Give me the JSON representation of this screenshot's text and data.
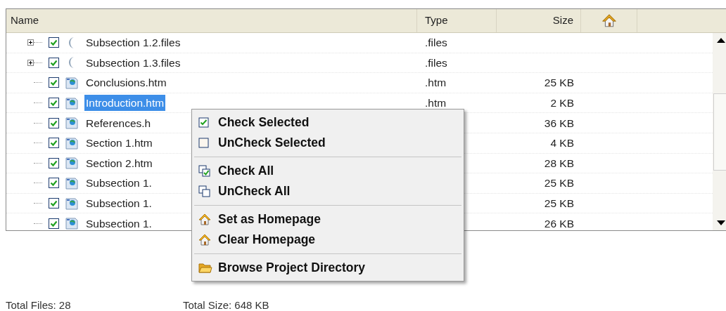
{
  "table": {
    "columns": [
      "Name",
      "Type",
      "Size"
    ],
    "rows": [
      {
        "kind": "folder",
        "expanded": false,
        "checked": true,
        "selected": false,
        "name": "Subsection 1.2.files",
        "type": ".files",
        "size": ""
      },
      {
        "kind": "folder",
        "expanded": false,
        "checked": true,
        "selected": false,
        "name": "Subsection 1.3.files",
        "type": ".files",
        "size": ""
      },
      {
        "kind": "page",
        "checked": true,
        "selected": false,
        "name": "Conclusions.htm",
        "type": ".htm",
        "size": "25 KB"
      },
      {
        "kind": "page",
        "checked": true,
        "selected": true,
        "name": "Introduction.htm",
        "type": ".htm",
        "size": "2 KB"
      },
      {
        "kind": "page",
        "checked": true,
        "selected": false,
        "name": "References.h",
        "type": "",
        "size": "36 KB"
      },
      {
        "kind": "page",
        "checked": true,
        "selected": false,
        "name": "Section 1.htm",
        "type": "",
        "size": "4 KB"
      },
      {
        "kind": "page",
        "checked": true,
        "selected": false,
        "name": "Section 2.htm",
        "type": "",
        "size": "28 KB"
      },
      {
        "kind": "page",
        "checked": true,
        "selected": false,
        "name": "Subsection 1.",
        "type": "",
        "size": "25 KB"
      },
      {
        "kind": "page",
        "checked": true,
        "selected": false,
        "name": "Subsection 1.",
        "type": "",
        "size": "25 KB"
      },
      {
        "kind": "page",
        "checked": true,
        "selected": false,
        "name": "Subsection 1.",
        "type": "",
        "size": "26 KB"
      }
    ]
  },
  "context_menu": {
    "groups": [
      [
        {
          "kind": "check",
          "label": "Check Selected"
        },
        {
          "kind": "uncheck",
          "label": "UnCheck Selected"
        }
      ],
      [
        {
          "kind": "check_all",
          "label": "Check All"
        },
        {
          "kind": "uncheck_all",
          "label": "UnCheck All"
        }
      ],
      [
        {
          "kind": "home",
          "label": "Set as Homepage"
        },
        {
          "kind": "home",
          "label": "Clear Homepage"
        }
      ],
      [
        {
          "kind": "folder",
          "label": "Browse Project Directory"
        }
      ]
    ]
  },
  "status_bar": {
    "total_files": {
      "label": "Total Files:",
      "value": "28"
    },
    "total_size": {
      "label": "Total Size:",
      "value": "648 KB"
    }
  }
}
